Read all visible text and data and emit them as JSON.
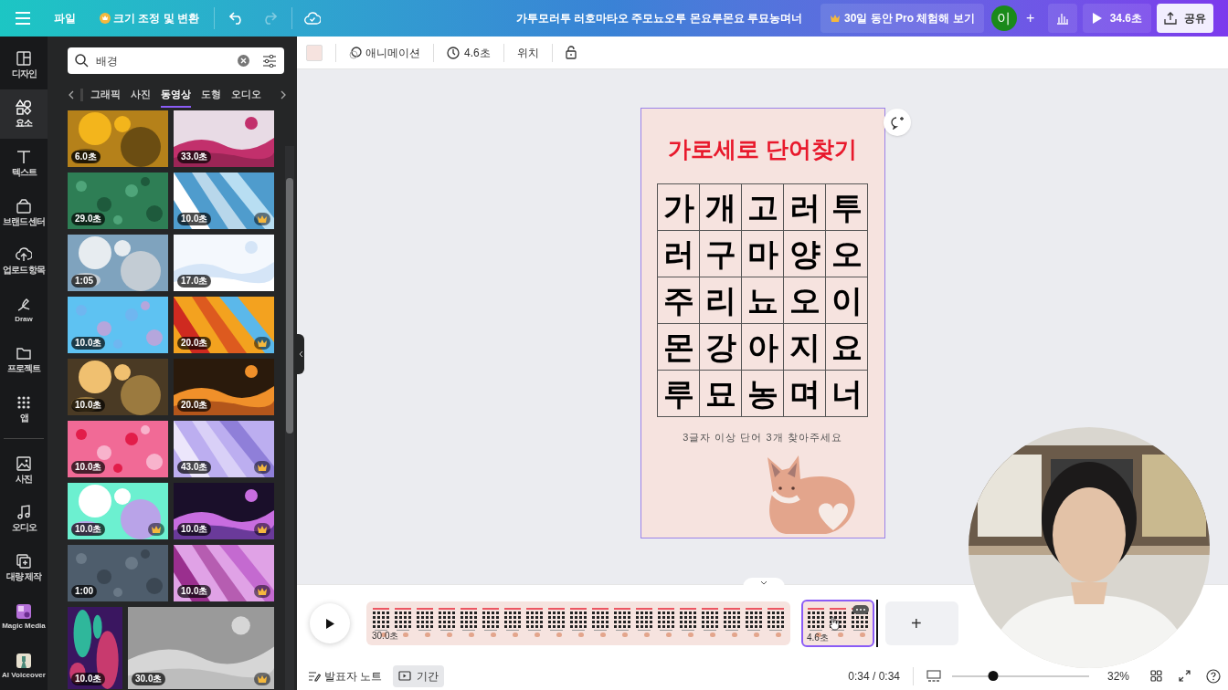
{
  "top_bar": {
    "file_menu": "파일",
    "resize_button": "크기 조정 및 변환",
    "redo_disabled": true,
    "title": "가투모러투 러호마타오 주모뇨오루 몬요루몬요 루묘농며너",
    "pro_trial_button": "30일 동안 Pro 체험해 보기",
    "avatar": "이",
    "add_button": "+",
    "play_button": "34.6초",
    "share_button": "공유"
  },
  "sidebar": {
    "items": [
      {
        "label": "디자인",
        "selected": false
      },
      {
        "label": "요소",
        "selected": true
      },
      {
        "label": "텍스트",
        "selected": false
      },
      {
        "label": "브랜드 센터",
        "selected": false
      },
      {
        "label": "업로드 항목",
        "selected": false
      },
      {
        "label": "Draw",
        "selected": false
      },
      {
        "label": "프로젝트",
        "selected": false
      },
      {
        "label": "앱",
        "selected": false
      },
      {
        "label": "사진",
        "selected": false
      },
      {
        "label": "오디오",
        "selected": false
      },
      {
        "label": "대량 제작",
        "selected": false
      },
      {
        "label": "Magic Media",
        "selected": false
      },
      {
        "label": "AI Voiceover",
        "selected": false
      }
    ]
  },
  "panel": {
    "search": {
      "value": "배경"
    },
    "tabs": [
      {
        "label": "그래픽",
        "selected": false
      },
      {
        "label": "사진",
        "selected": false
      },
      {
        "label": "동영상",
        "selected": true
      },
      {
        "label": "도형",
        "selected": false
      },
      {
        "label": "오디오",
        "selected": false
      }
    ],
    "videos": [
      {
        "duration": "6.0초",
        "premium": false
      },
      {
        "duration": "33.0초",
        "premium": false
      },
      {
        "duration": "29.0초",
        "premium": false
      },
      {
        "duration": "10.0초",
        "premium": true
      },
      {
        "duration": "1:05",
        "premium": false
      },
      {
        "duration": "17.0초",
        "premium": false
      },
      {
        "duration": "10.0초",
        "premium": false
      },
      {
        "duration": "20.0초",
        "premium": true
      },
      {
        "duration": "10.0초",
        "premium": false
      },
      {
        "duration": "20.0초",
        "premium": false
      },
      {
        "duration": "10.0초",
        "premium": false
      },
      {
        "duration": "43.0초",
        "premium": true
      },
      {
        "duration": "10.0초",
        "premium": true
      },
      {
        "duration": "10.0초",
        "premium": true
      },
      {
        "duration": "1:00",
        "premium": false
      },
      {
        "duration": "10.0초",
        "premium": true
      },
      {
        "duration": "10.0초",
        "premium": false
      },
      {
        "duration": "30.0초",
        "premium": true
      }
    ]
  },
  "toolbar": {
    "animation_button": "애니메이션",
    "duration_button": "4.6초",
    "position_button": "위치"
  },
  "design": {
    "title": "가로세로 단어찾기",
    "grid": [
      [
        "가",
        "개",
        "고",
        "러",
        "투"
      ],
      [
        "러",
        "구",
        "마",
        "양",
        "오"
      ],
      [
        "주",
        "리",
        "뇨",
        "오",
        "이"
      ],
      [
        "몬",
        "강",
        "아",
        "지",
        "요"
      ],
      [
        "루",
        "묘",
        "농",
        "며",
        "너"
      ]
    ],
    "instruction": "3글자 이상 단어 3개 찾아주세요"
  },
  "timeline": {
    "pages": [
      {
        "duration": "30.0초",
        "selected": false
      },
      {
        "duration": "4.6초",
        "selected": true
      }
    ],
    "add_page": "+"
  },
  "bottom_bar": {
    "notes_button": "발표자 노트",
    "duration_button": {
      "label": "기간",
      "selected": true
    },
    "time": "0:34 / 0:34",
    "zoom": {
      "level": 0.3,
      "reading": "32%"
    }
  }
}
